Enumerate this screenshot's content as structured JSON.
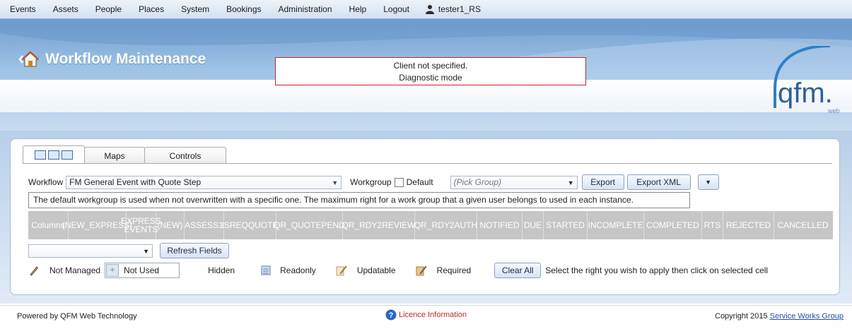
{
  "menu": [
    "Events",
    "Assets",
    "People",
    "Places",
    "System",
    "Bookings",
    "Administration",
    "Help",
    "Logout"
  ],
  "user": "tester1_RS",
  "header": {
    "title": "Workflow Maintenance",
    "diag_line1": "Client not specified.",
    "diag_line2": "Diagnostic mode",
    "logo_text": "qfm.",
    "logo_sub": "web"
  },
  "tabs": {
    "maps": "Maps",
    "controls": "Controls"
  },
  "workflow": {
    "label": "Workflow",
    "value": "FM General Event with Quote Step",
    "workgroup_label": "Workgroup",
    "default_label": "Default",
    "group_placeholder": "(Pick Group)",
    "export": "Export",
    "export_xml": "Export XML"
  },
  "info_text": "The default workgroup is used when not overwritten with a specific one. The maximum right for a work group that a given user belongs to used in each instance.",
  "columns": [
    "Columns",
    "(NEW_EXPRESS)",
    "EXPRESS EVENTS",
    "(NEW)",
    "ASSESS1",
    "ISREQQUOTE",
    "QR_QUOTEPEND",
    "QR_RDY2REVIEW",
    "QR_RDY2AUTH",
    "NOTIFIED",
    "DUE",
    "STARTED",
    "INCOMPLETE",
    "COMPLETED",
    "RTS",
    "REJECTED",
    "CANCELLED"
  ],
  "refresh_fields": "Refresh Fields",
  "legend": {
    "not_managed": "Not Managed",
    "not_used": "Not Used",
    "hidden": "Hidden",
    "readonly": "Readonly",
    "updatable": "Updatable",
    "required": "Required",
    "clear_all": "Clear All",
    "hint": "Select the right you wish to apply then click on selected cell"
  },
  "footer": {
    "powered": "Powered by QFM Web Technology",
    "licence": "Licence Information",
    "copyright": "Copyright 2015",
    "company": "Service Works Group"
  },
  "colors": {
    "accent": "#c0282a",
    "header": "#8fb6e0",
    "colbar": "#c6c6c6"
  }
}
